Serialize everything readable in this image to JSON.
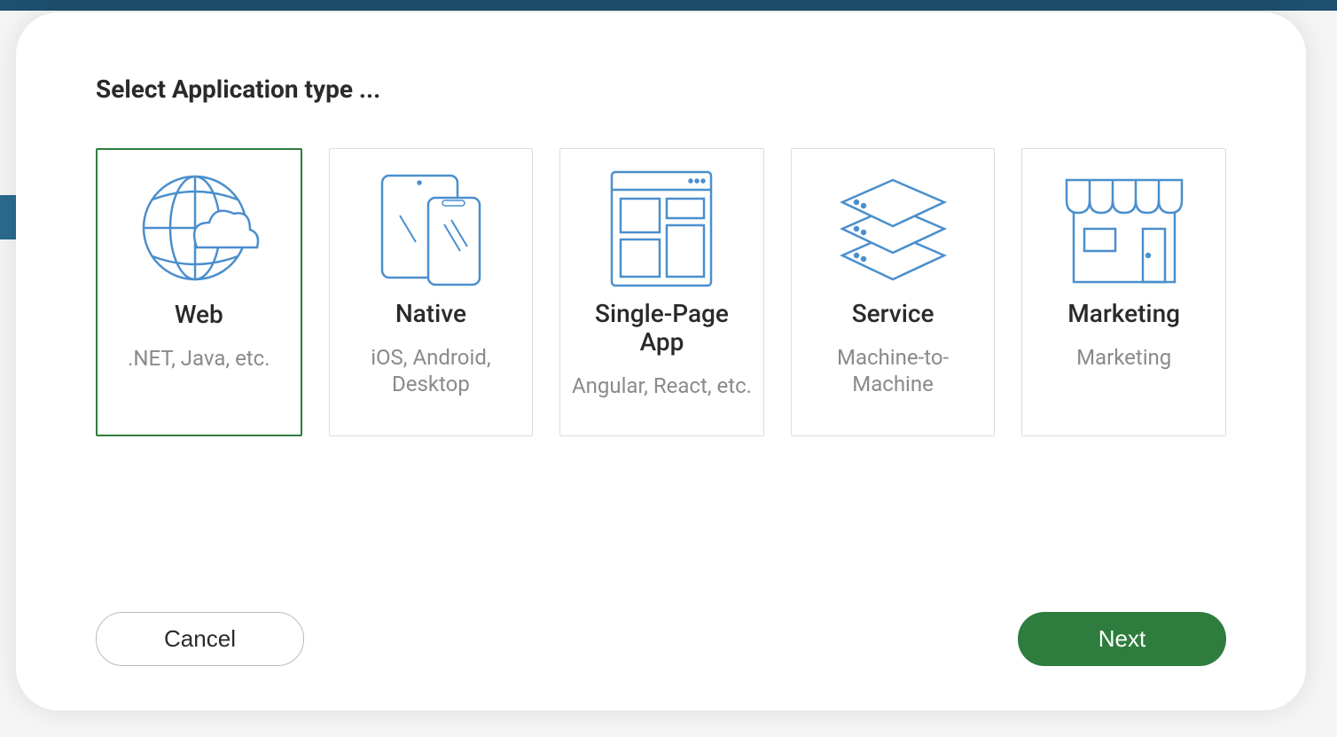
{
  "modal": {
    "title": "Select Application type ...",
    "cards": [
      {
        "title": "Web",
        "subtitle": ".NET, Java, etc.",
        "selected": true,
        "icon": "globe-cloud"
      },
      {
        "title": "Native",
        "subtitle": "iOS, Android, Desktop",
        "selected": false,
        "icon": "devices"
      },
      {
        "title": "Single-Page App",
        "subtitle": "Angular, React, etc.",
        "selected": false,
        "icon": "browser-layout"
      },
      {
        "title": "Service",
        "subtitle": "Machine-to-Machine",
        "selected": false,
        "icon": "stack"
      },
      {
        "title": "Marketing",
        "subtitle": "Marketing",
        "selected": false,
        "icon": "storefront"
      }
    ],
    "buttons": {
      "cancel": "Cancel",
      "next": "Next"
    }
  }
}
